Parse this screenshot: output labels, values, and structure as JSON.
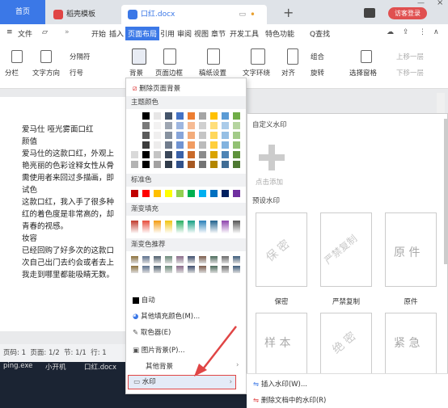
{
  "tabs": {
    "home": "首页",
    "daoke": "稻壳模板",
    "doc": "口红.docx",
    "login": "访客登录"
  },
  "menubar": {
    "file": "文件",
    "items": [
      "开始",
      "插入",
      "页面布局",
      "引用",
      "审阅",
      "视图",
      "章节",
      "开发工具",
      "特色功能"
    ],
    "active": "页面布局",
    "search": "Q查找"
  },
  "ribbon": {
    "columns": "分栏",
    "text_direction": "文字方向",
    "page_separator": "分隔符",
    "line_numbers": "行号",
    "background": "背景",
    "page_border": "页面边框",
    "manuscript": "稿纸设置",
    "text_wrap": "文字环绕",
    "align": "对齐",
    "group": "组合",
    "rotate": "旋转",
    "select_pane": "选择窗格",
    "move_up": "上移一层",
    "move_down": "下移一层"
  },
  "document": {
    "lines": [
      "爱马仕 哑光雾面口红",
      "颜值",
      "爱马仕的这款口红，外观上",
      "艳亮丽的色彩诠释女性从骨",
      "需使用者来回过多描画，即",
      "试色",
      "这款口红，我入手了很多种",
      "红的着色度是非常高的，却",
      "青春的视感。",
      "妆容",
      "已经回购了好多次的这款口",
      "次自己出门去约会或者去上",
      "我走到哪里都能吸睛无数。"
    ]
  },
  "statusbar": {
    "page": "页码: 1",
    "pages": "页面: 1/2",
    "section": "节: 1/1",
    "row": "行: 1"
  },
  "taskbar": {
    "items": [
      "ping.exe",
      "小开机",
      "口红.docx"
    ]
  },
  "colormenu": {
    "remove_bg": "删除页面背景",
    "theme_colors": "主题颜色",
    "standard_colors": "标准色",
    "gradient_fill": "渐变填充",
    "gradient_recommend": "渐变色推荐",
    "auto": "自动",
    "more_colors": "其他填充颜色(M)...",
    "picker": "取色器(E)",
    "picture_bg": "图片背景(P)...",
    "other_bg": "其他背景",
    "watermark": "水印"
  },
  "watermark": {
    "custom_title": "自定义水印",
    "click_add": "点击添加",
    "preset_title": "预设水印",
    "presets": [
      {
        "label": "保密",
        "text": "保 密"
      },
      {
        "label": "严禁复制",
        "text": "严禁复制"
      },
      {
        "label": "原件",
        "text": "原 件"
      },
      {
        "label": "",
        "text": "样 本"
      },
      {
        "label": "",
        "text": "绝 密"
      },
      {
        "label": "",
        "text": "紧 急"
      }
    ],
    "insert": "插入水印(W)...",
    "delete": "删除文档中的水印(R)"
  },
  "colors": {
    "accent": "#3b78e7",
    "active_tab": "#3b78e7",
    "login": "#e05050",
    "watermark_highlight": "#e04545"
  }
}
